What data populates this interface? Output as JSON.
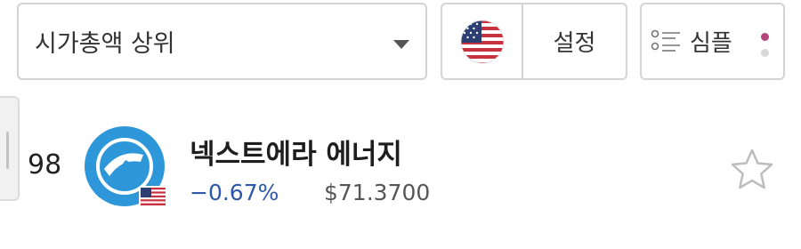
{
  "header": {
    "sort_select": {
      "label": "시가총액 상위"
    },
    "region": {
      "flag": "us-flag-icon",
      "settings_label": "설정"
    },
    "view_toggle": {
      "icon": "list-icon",
      "label": "심플"
    }
  },
  "stock": {
    "rank": "98",
    "name": "넥스트에라 에너지",
    "logo": "nextera-logo-icon",
    "country_flag": "us-flag-icon",
    "change": "−0.67%",
    "price": "$71.3700",
    "watchlist_icon": "star-outline-icon"
  },
  "colors": {
    "accent_blue": "#2f57a8",
    "logo_blue": "#2e97d9",
    "dot_active": "#b5467a"
  }
}
